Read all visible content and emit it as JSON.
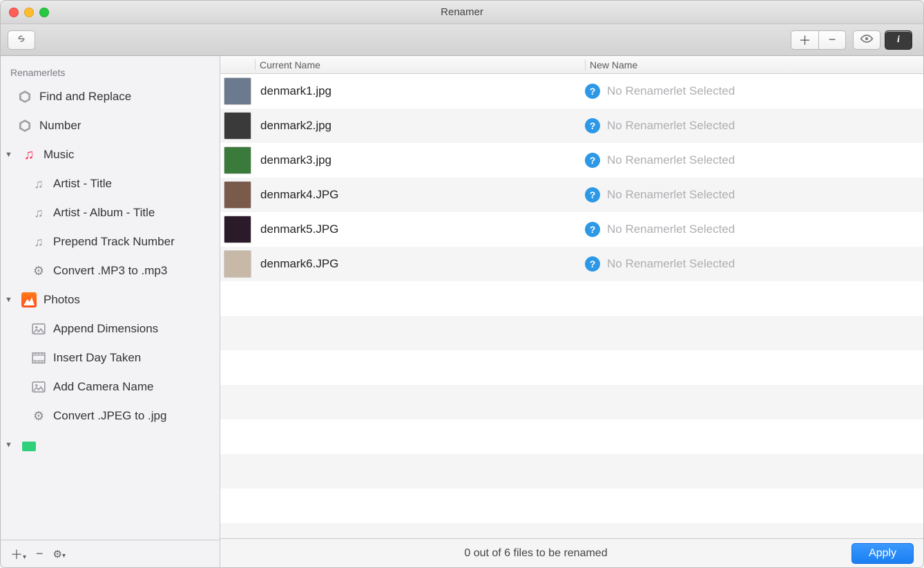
{
  "window": {
    "title": "Renamer"
  },
  "toolbar": {
    "link_icon": "link",
    "plus_icon": "+",
    "minus_icon": "−",
    "eye_icon": "eye",
    "info_icon": "i"
  },
  "sidebar": {
    "header": "Renamerlets",
    "items": [
      {
        "kind": "item",
        "icon": "cube",
        "label": "Find and Replace"
      },
      {
        "kind": "item",
        "icon": "cube",
        "label": "Number"
      },
      {
        "kind": "group",
        "icon": "music",
        "label": "Music",
        "expanded": true
      },
      {
        "kind": "child",
        "icon": "note",
        "label": "Artist - Title"
      },
      {
        "kind": "child",
        "icon": "note",
        "label": "Artist - Album - Title"
      },
      {
        "kind": "child",
        "icon": "note",
        "label": "Prepend Track Number"
      },
      {
        "kind": "child",
        "icon": "gear",
        "label": "Convert .MP3 to .mp3"
      },
      {
        "kind": "group",
        "icon": "photo",
        "label": "Photos",
        "expanded": true
      },
      {
        "kind": "child",
        "icon": "img",
        "label": "Append Dimensions"
      },
      {
        "kind": "child",
        "icon": "film",
        "label": "Insert Day Taken"
      },
      {
        "kind": "child",
        "icon": "img",
        "label": "Add Camera Name"
      },
      {
        "kind": "child",
        "icon": "gear",
        "label": "Convert .JPEG to .jpg"
      },
      {
        "kind": "group",
        "icon": "archive",
        "label": "",
        "expanded": true
      }
    ],
    "footer": {
      "add": "+",
      "remove": "−",
      "gear": "⚙"
    }
  },
  "columns": {
    "thumb": "",
    "current": "Current Name",
    "newname": "New Name"
  },
  "files": [
    {
      "current": "denmark1.jpg",
      "msg": "No Renamerlet Selected"
    },
    {
      "current": "denmark2.jpg",
      "msg": "No Renamerlet Selected"
    },
    {
      "current": "denmark3.jpg",
      "msg": "No Renamerlet Selected"
    },
    {
      "current": "denmark4.JPG",
      "msg": "No Renamerlet Selected"
    },
    {
      "current": "denmark5.JPG",
      "msg": "No Renamerlet Selected"
    },
    {
      "current": "denmark6.JPG",
      "msg": "No Renamerlet Selected"
    }
  ],
  "footer": {
    "status": "0 out of 6 files to be renamed",
    "apply": "Apply"
  }
}
